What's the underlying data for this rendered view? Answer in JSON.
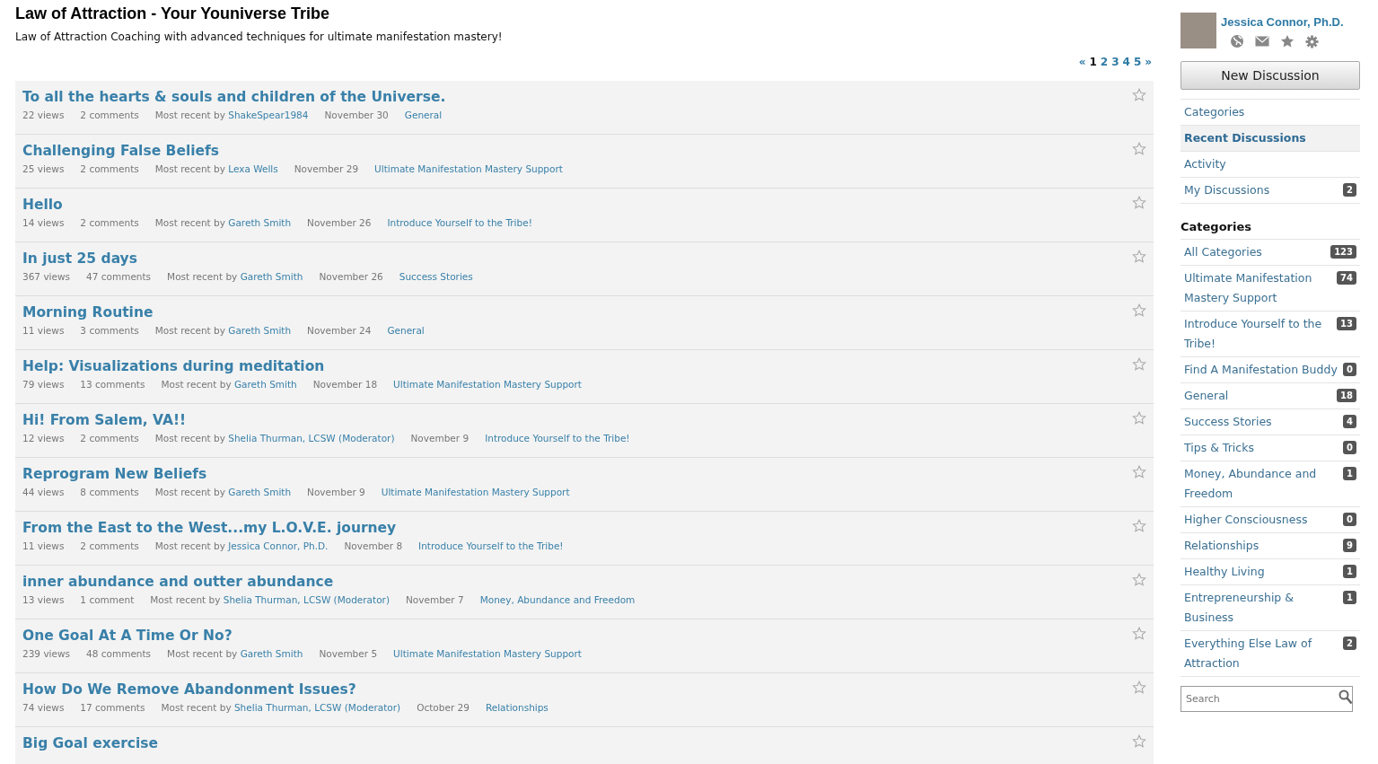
{
  "header": {
    "title": "Law of Attraction - Your Youniverse Tribe",
    "description": "Law of Attraction Coaching with advanced techniques for ultimate manifestation mastery!"
  },
  "pager": [
    {
      "label": "«",
      "selected": false
    },
    {
      "label": "1",
      "selected": true
    },
    {
      "label": "2",
      "selected": false
    },
    {
      "label": "3",
      "selected": false
    },
    {
      "label": "4",
      "selected": false
    },
    {
      "label": "5",
      "selected": false
    },
    {
      "label": "»",
      "selected": false
    }
  ],
  "discussions": [
    {
      "title": "To all the hearts & souls and children of the Universe.",
      "views": "22 views",
      "comments": "2 comments",
      "recent_label": "Most recent by",
      "author": "ShakeSpear1984",
      "date": "November 30",
      "category": "General",
      "bookmarked": false
    },
    {
      "title": "Challenging False Beliefs",
      "views": "25 views",
      "comments": "2 comments",
      "recent_label": "Most recent by",
      "author": "Lexa Wells",
      "date": "November 29",
      "category": "Ultimate Manifestation Mastery Support",
      "bookmarked": false
    },
    {
      "title": "Hello",
      "views": "14 views",
      "comments": "2 comments",
      "recent_label": "Most recent by",
      "author": "Gareth Smith",
      "date": "November 26",
      "category": "Introduce Yourself to the Tribe!",
      "bookmarked": false
    },
    {
      "title": "In just 25 days",
      "views": "367 views",
      "comments": "47 comments",
      "recent_label": "Most recent by",
      "author": "Gareth Smith",
      "date": "November 26",
      "category": "Success Stories",
      "bookmarked": false
    },
    {
      "title": "Morning Routine",
      "views": "11 views",
      "comments": "3 comments",
      "recent_label": "Most recent by",
      "author": "Gareth Smith",
      "date": "November 24",
      "category": "General",
      "bookmarked": false
    },
    {
      "title": "Help: Visualizations during meditation",
      "views": "79 views",
      "comments": "13 comments",
      "recent_label": "Most recent by",
      "author": "Gareth Smith",
      "date": "November 18",
      "category": "Ultimate Manifestation Mastery Support",
      "bookmarked": false
    },
    {
      "title": "Hi! From Salem, VA!!",
      "views": "12 views",
      "comments": "2 comments",
      "recent_label": "Most recent by",
      "author": "Shelia Thurman, LCSW (Moderator)",
      "date": "November 9",
      "category": "Introduce Yourself to the Tribe!",
      "bookmarked": false
    },
    {
      "title": "Reprogram New Beliefs",
      "views": "44 views",
      "comments": "8 comments",
      "recent_label": "Most recent by",
      "author": "Gareth Smith",
      "date": "November 9",
      "category": "Ultimate Manifestation Mastery Support",
      "bookmarked": false
    },
    {
      "title": "From the East to the West...my L.O.V.E. journey",
      "views": "11 views",
      "comments": "2 comments",
      "recent_label": "Most recent by",
      "author": "Jessica Connor, Ph.D.",
      "date": "November 8",
      "category": "Introduce Yourself to the Tribe!",
      "bookmarked": false
    },
    {
      "title": "inner abundance and outter abundance",
      "views": "13 views",
      "comments": "1 comment",
      "recent_label": "Most recent by",
      "author": "Shelia Thurman, LCSW (Moderator)",
      "date": "November 7",
      "category": "Money, Abundance and Freedom",
      "bookmarked": false
    },
    {
      "title": "One Goal At A Time Or No?",
      "views": "239 views",
      "comments": "48 comments",
      "recent_label": "Most recent by",
      "author": "Gareth Smith",
      "date": "November 5",
      "category": "Ultimate Manifestation Mastery Support",
      "bookmarked": false
    },
    {
      "title": "How Do We Remove Abandonment Issues?",
      "views": "74 views",
      "comments": "17 comments",
      "recent_label": "Most recent by",
      "author": "Shelia Thurman, LCSW (Moderator)",
      "date": "October 29",
      "category": "Relationships",
      "bookmarked": false
    },
    {
      "title": "Big Goal exercise",
      "bookmarked": false
    }
  ],
  "profile": {
    "name": "Jessica Connor, Ph.D."
  },
  "new_discussion_button": "New Discussion",
  "nav": [
    {
      "label": "Categories",
      "selected": false
    },
    {
      "label": "Recent Discussions",
      "selected": true
    },
    {
      "label": "Activity",
      "selected": false
    },
    {
      "label": "My Discussions",
      "count": "2",
      "selected": false
    }
  ],
  "categories_heading": "Categories",
  "categories": [
    {
      "label": "All Categories",
      "count": "123"
    },
    {
      "label": "Ultimate Manifestation Mastery Support",
      "count": "74"
    },
    {
      "label": "Introduce Yourself to the Tribe!",
      "count": "13"
    },
    {
      "label": "Find A Manifestation Buddy",
      "count": "0"
    },
    {
      "label": "General",
      "count": "18"
    },
    {
      "label": "Success Stories",
      "count": "4"
    },
    {
      "label": "Tips & Tricks",
      "count": "0"
    },
    {
      "label": "Money, Abundance and Freedom",
      "count": "1"
    },
    {
      "label": "Higher Consciousness",
      "count": "0"
    },
    {
      "label": "Relationships",
      "count": "9"
    },
    {
      "label": "Healthy Living",
      "count": "1"
    },
    {
      "label": "Entrepreneurship & Business",
      "count": "1"
    },
    {
      "label": "Everything Else Law of Attraction",
      "count": "2"
    }
  ],
  "search": {
    "placeholder": "Search"
  }
}
